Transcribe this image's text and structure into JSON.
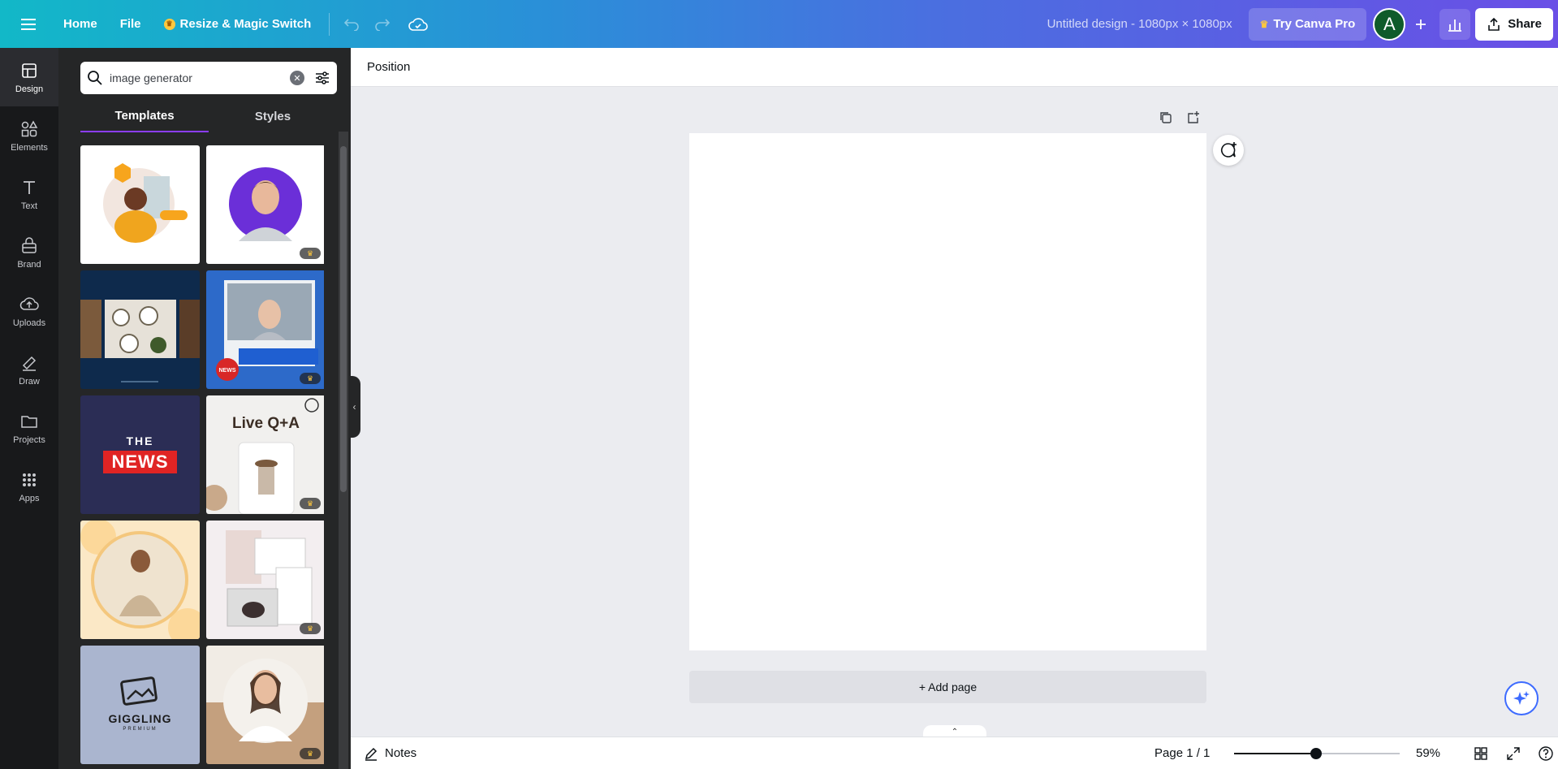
{
  "header": {
    "home_label": "Home",
    "file_label": "File",
    "resize_label": "Resize & Magic Switch",
    "design_title": "Untitled design - 1080px × 1080px",
    "try_pro_label": "Try Canva Pro",
    "avatar_initial": "A",
    "share_label": "Share",
    "gradient_start": "#12b8c8",
    "gradient_end": "#6a4fe6"
  },
  "rail": {
    "items": [
      {
        "label": "Design",
        "icon": "design-icon"
      },
      {
        "label": "Elements",
        "icon": "elements-icon"
      },
      {
        "label": "Text",
        "icon": "text-icon"
      },
      {
        "label": "Brand",
        "icon": "brand-icon"
      },
      {
        "label": "Uploads",
        "icon": "uploads-icon"
      },
      {
        "label": "Draw",
        "icon": "draw-icon"
      },
      {
        "label": "Projects",
        "icon": "projects-icon"
      },
      {
        "label": "Apps",
        "icon": "apps-icon"
      }
    ]
  },
  "panel": {
    "search_value": "image generator",
    "tabs": [
      {
        "label": "Templates"
      },
      {
        "label": "Styles"
      }
    ],
    "templates": {
      "t3_title": "THE",
      "t3_badge": "NEWS",
      "t4_title": "Live Q+A",
      "t9_title": "GIGGLING",
      "t9_sub": "PREMIUM",
      "t2_news": "NEWS"
    },
    "accent": "#8b3dff"
  },
  "toolbar": {
    "position_label": "Position"
  },
  "canvas": {
    "add_page_label": "+ Add page"
  },
  "bottom": {
    "notes_label": "Notes",
    "page_indicator": "Page 1 / 1",
    "zoom_label": "59%",
    "zoom_fraction": 0.59
  }
}
